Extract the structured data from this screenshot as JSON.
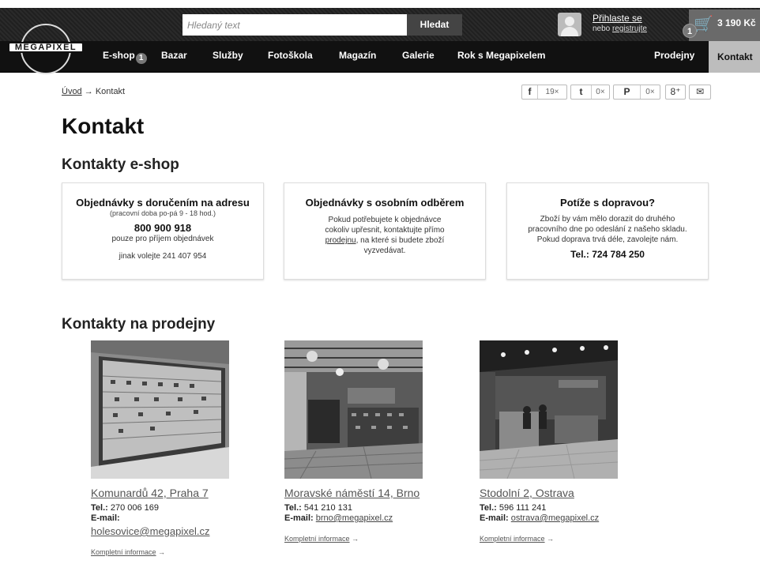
{
  "header": {
    "logo_text": "MEGAPIXEL",
    "search_placeholder": "Hledaný text",
    "search_button": "Hledat",
    "login_link": "Přihlaste se",
    "login_or": "nebo ",
    "register_link": "registrujte",
    "cart_count": "1",
    "cart_price": "3 190 Kč"
  },
  "nav": {
    "eshop": "E-shop",
    "eshop_badge": "1",
    "bazar": "Bazar",
    "sluzby": "Služby",
    "fotoskola": "Fotoškola",
    "magazin": "Magazín",
    "galerie": "Galerie",
    "rok": "Rok s Megapixelem",
    "prodejny": "Prodejny",
    "kontakt": "Kontakt"
  },
  "breadcrumb": {
    "home": "Úvod",
    "arrow": " → ",
    "current": "Kontakt"
  },
  "social": {
    "facebook_icon": "f",
    "facebook_count": "19×",
    "twitter_icon": "t",
    "twitter_count": "0×",
    "pinterest_icon": "P",
    "pinterest_count": "0×",
    "gplus_icon": "8⁺",
    "mail_icon": "✉"
  },
  "page_title": "Kontakt",
  "eshop_section": {
    "title": "Kontakty e-shop",
    "card1": {
      "title": "Objednávky s doručením na adresu",
      "hours": "(pracovní doba po-pá 9 - 18 hod.)",
      "phone": "800 900 918",
      "note": "pouze pro příjem objednávek",
      "alt": "jinak volejte 241 407 954"
    },
    "card2": {
      "title": "Objednávky s osobním odběrem",
      "line1": "Pokud potřebujete k objednávce",
      "line2": "cokoliv upřesnit, kontaktujte přímo",
      "link": "prodejnu",
      "line3": ", na které si budete zboží",
      "line4": "vyzvedávat."
    },
    "card3": {
      "title": "Potíže s dopravou?",
      "line1": "Zboží by vám mělo dorazit do druhého",
      "line2": "pracovního dne po odeslání z našeho skladu.",
      "line3": "Pokud doprava trvá déle, zavolejte nám.",
      "phone": "Tel.: 724 784 250"
    }
  },
  "stores_section": {
    "title": "Kontakty na prodejny",
    "tel_label": "Tel.:",
    "email_label": "E-mail:",
    "more": "Kompletní informace",
    "more_arrow": " →",
    "stores": [
      {
        "name": "Komunardů 42, Praha 7",
        "tel": " 270 006 169",
        "email": "holesovice@megapixel.cz"
      },
      {
        "name": "Moravské náměstí 14, Brno",
        "tel": " 541 210 131",
        "email": "brno@megapixel.cz"
      },
      {
        "name": "Stodolní 2, Ostrava",
        "tel": " 596 111 241",
        "email": "ostrava@megapixel.cz"
      }
    ]
  }
}
